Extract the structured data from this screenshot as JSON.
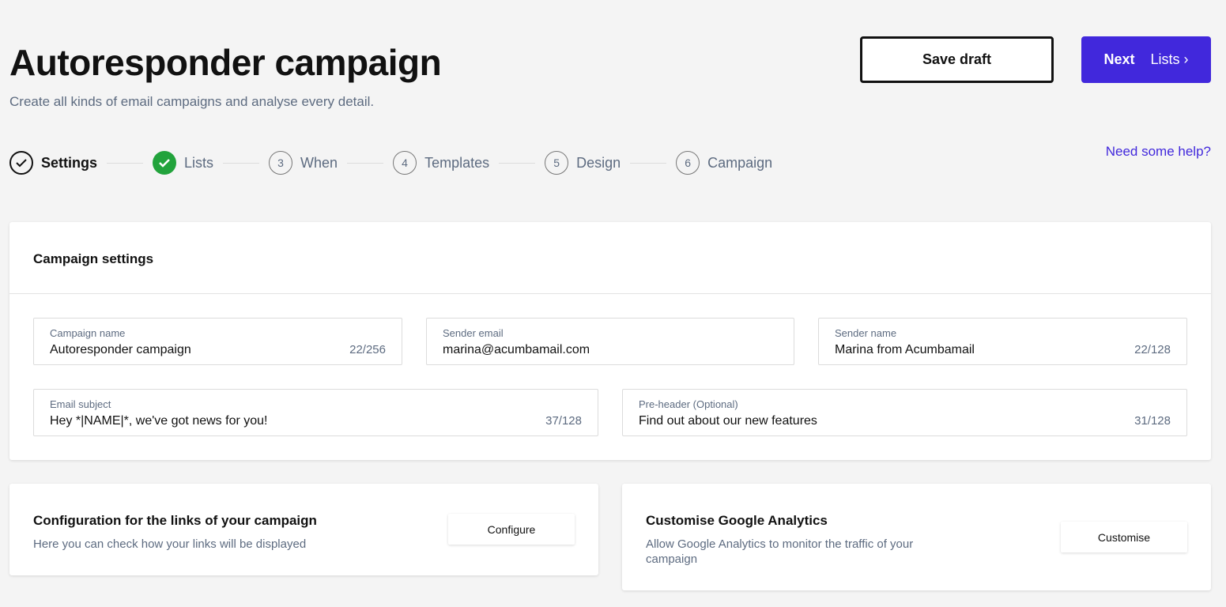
{
  "header": {
    "title": "Autoresponder campaign",
    "subtitle": "Create all kinds of email campaigns and analyse every detail.",
    "save_label": "Save draft",
    "next_label": "Next",
    "next_target": "Lists",
    "help_link": "Need some help?"
  },
  "steps": [
    {
      "label": "Settings",
      "state": "current"
    },
    {
      "label": "Lists",
      "state": "done"
    },
    {
      "num": "3",
      "label": "When"
    },
    {
      "num": "4",
      "label": "Templates"
    },
    {
      "num": "5",
      "label": "Design"
    },
    {
      "num": "6",
      "label": "Campaign"
    }
  ],
  "settings": {
    "title": "Campaign settings",
    "fields": [
      {
        "label": "Campaign name",
        "value": "Autoresponder campaign",
        "count": "22/256"
      },
      {
        "label": "Sender email",
        "value": "marina@acumbamail.com"
      },
      {
        "label": "Sender name",
        "value": "Marina from Acumbamail",
        "count": "22/128"
      },
      {
        "label": "Email subject",
        "value": "Hey *|NAME|*, we've got news for you!",
        "count": "37/128"
      },
      {
        "label": "Pre-header (Optional)",
        "value": "Find out about our new features",
        "count": "31/128"
      }
    ]
  },
  "links": {
    "title": "Configuration for the links of your campaign",
    "desc": "Here you can check how your links will be displayed",
    "button": "Configure"
  },
  "analytics": {
    "title": "Customise Google Analytics",
    "desc": "Allow Google Analytics to monitor the traffic of your campaign",
    "button": "Customise"
  },
  "colors": {
    "accent": "#4128dc",
    "success": "#22a33c"
  }
}
